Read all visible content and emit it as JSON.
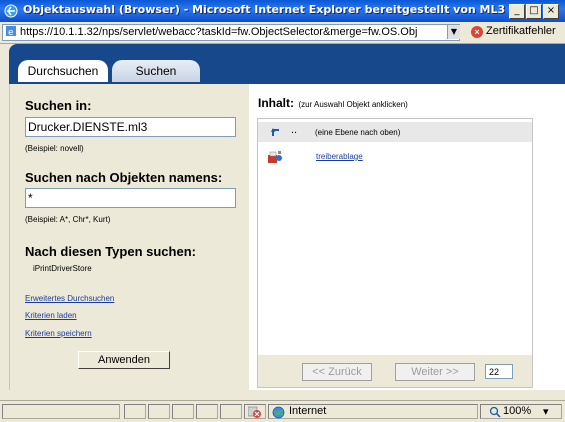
{
  "window": {
    "title": "Objektauswahl (Browser) - Microsoft Internet Explorer bereitgestellt von ML3",
    "buttons": [
      "_",
      "□",
      "×"
    ]
  },
  "addressbar": {
    "url": "https://10.1.1.32/nps/servlet/webacc?taskId=fw.ObjectSelector&merge=fw.OS.Obj",
    "cert_error": "Zertifikatfehler"
  },
  "tabs": [
    {
      "label": "Durchsuchen",
      "active": true
    },
    {
      "label": "Suchen",
      "active": false
    }
  ],
  "left": {
    "search_in_label": "Suchen in:",
    "search_in_value": "Drucker.DIENSTE.ml3",
    "search_in_example": "(Beispiel: novell)",
    "search_name_label": "Suchen nach Objekten namens:",
    "search_name_value": "*",
    "search_name_example": "(Beispiel: A*, Chr*, Kurt)",
    "types_label": "Nach diesen Typen suchen:",
    "types_value": "iPrintDriverStore",
    "links": [
      "Erweitertes Durchsuchen",
      "Kriterien laden",
      "Kriterien speichern"
    ],
    "apply_button": "Anwenden"
  },
  "right": {
    "heading": "Inhalt:",
    "hint": "(zur Auswahl Objekt anklicken)",
    "up_dots": "..",
    "up_text": "(eine Ebene nach oben)",
    "items": [
      {
        "label": "treiberablage",
        "icon": "driver-store-icon"
      }
    ],
    "back_button": "<< Zurück",
    "next_button": "Weiter >>",
    "page_size": "22"
  },
  "statusbar": {
    "zone": "Internet",
    "zoom": "100%",
    "zoom_arrow": "▾"
  }
}
